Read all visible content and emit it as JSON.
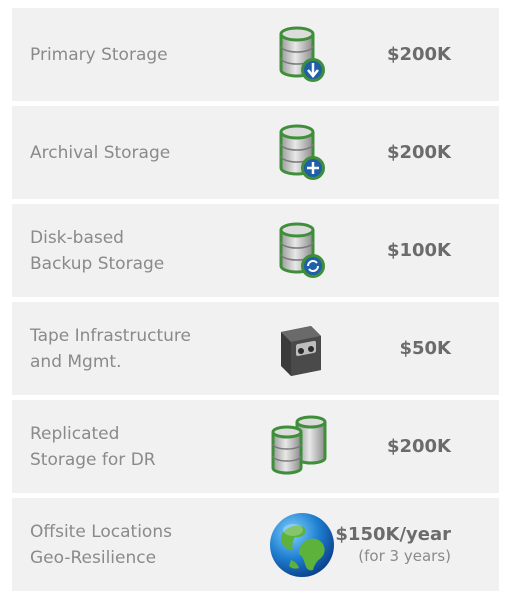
{
  "rows": [
    {
      "label": "Primary Storage",
      "icon": "database-download-icon",
      "cost": "$200K",
      "cost_note": ""
    },
    {
      "label": "Archival Storage",
      "icon": "database-add-icon",
      "cost": "$200K",
      "cost_note": ""
    },
    {
      "label": "Disk-based\nBackup Storage",
      "icon": "database-sync-icon",
      "cost": "$100K",
      "cost_note": ""
    },
    {
      "label": "Tape Infrastructure\nand Mgmt.",
      "icon": "tape-drive-icon",
      "cost": "$50K",
      "cost_note": ""
    },
    {
      "label": "Replicated\nStorage for DR",
      "icon": "replicated-database-icon",
      "cost": "$200K",
      "cost_note": ""
    },
    {
      "label": "Offsite Locations\nGeo-Resilience",
      "icon": "globe-icon",
      "cost": "$150K/year",
      "cost_note": "(for 3 years)"
    }
  ],
  "colors": {
    "row_background": "#f1f1f1",
    "label_text": "#8a8a8a",
    "cost_text": "#6b6b6b",
    "icon_green": "#3f8f3a",
    "icon_blue": "#1f5fa8"
  }
}
